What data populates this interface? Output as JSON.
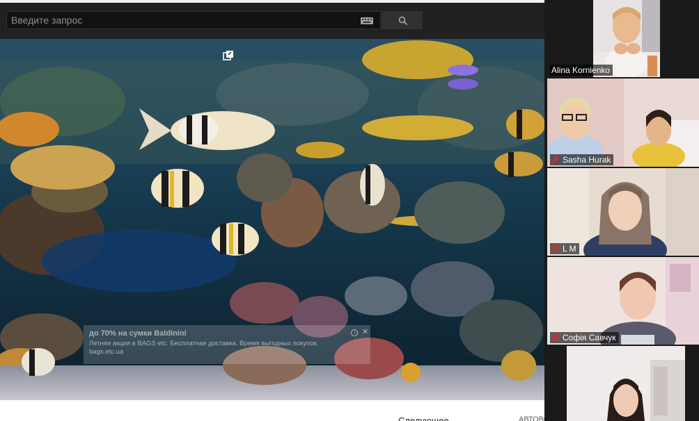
{
  "browser": {
    "search": {
      "placeholder": "Введите запрос"
    },
    "icons": {
      "keyboard": "keyboard-icon",
      "search": "search-icon",
      "miniplayer": "miniplayer-icon"
    }
  },
  "video": {
    "scene": "aquarium",
    "ad": {
      "title": "до 70% на сумки Baldinini",
      "description": "Летняя акция в BAGS etc. Бесплатная доставка. Время выгодных покупок.",
      "domain": "bags.etc.ua",
      "info_icon": "info-icon",
      "close_icon": "close-icon"
    }
  },
  "below_video": {
    "up_next": "Следующее",
    "autoplay": "АВТОВОСПР."
  },
  "participants": [
    {
      "name": "Alina Kornienko",
      "muted": false
    },
    {
      "name": "Sasha Hurak",
      "muted": true
    },
    {
      "name": "L M",
      "muted": true
    },
    {
      "name": "Софія Савчук",
      "muted": true
    },
    {
      "name": "",
      "muted": false
    }
  ],
  "colors": {
    "topbar": "#212121",
    "mic_muted": "#e02828",
    "panel": "#1a1a1a"
  }
}
